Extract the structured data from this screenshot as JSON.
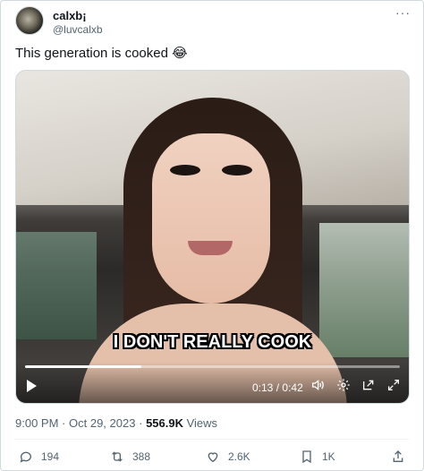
{
  "author": {
    "display_name": "calxb¡",
    "handle": "@luvcalxb",
    "more_icon": "more-dots-icon"
  },
  "tweet": {
    "text": "This generation is cooked",
    "emoji": "😂"
  },
  "video": {
    "caption": "I DON'T REALLY COOK",
    "elapsed": "0:13",
    "duration": "0:42",
    "time_separator": "/",
    "progress_fraction": 0.31
  },
  "meta": {
    "time": "9:00 PM",
    "date": "Oct 29, 2023",
    "views_count": "556.9K",
    "views_label": "Views",
    "separator": "·"
  },
  "actions": {
    "replies": "194",
    "reposts": "388",
    "likes": "2.6K",
    "bookmarks": "1K"
  },
  "colors": {
    "text_primary": "#0f1419",
    "text_secondary": "#536471",
    "border": "#cfd9de"
  }
}
